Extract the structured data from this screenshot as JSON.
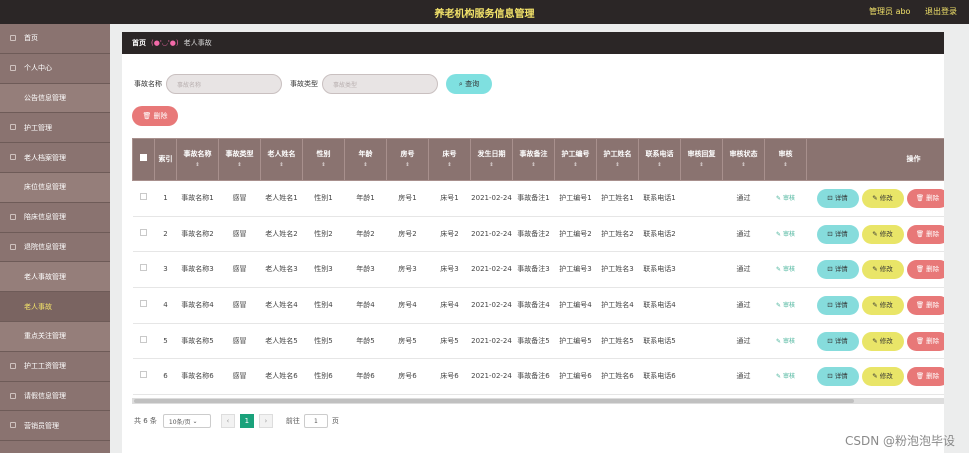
{
  "header": {
    "title": "养老机构服务信息管理",
    "user": "管理员 abo",
    "logout": "退出登录"
  },
  "sidebar": {
    "items": [
      {
        "label": "首页",
        "sub": false,
        "active": false
      },
      {
        "label": "个人中心",
        "sub": false,
        "active": false
      },
      {
        "label": "公告信息管理",
        "sub": true,
        "active": false
      },
      {
        "label": "护工管理",
        "sub": false,
        "active": false
      },
      {
        "label": "老人档案管理",
        "sub": false,
        "active": false
      },
      {
        "label": "床位信息管理",
        "sub": true,
        "active": false
      },
      {
        "label": "陪床信息管理",
        "sub": false,
        "active": false
      },
      {
        "label": "退院信息管理",
        "sub": false,
        "active": false
      },
      {
        "label": "老人事故管理",
        "sub": true,
        "active": false
      },
      {
        "label": "老人事故",
        "sub": true,
        "active": true
      },
      {
        "label": "重点关注管理",
        "sub": true,
        "active": false
      },
      {
        "label": "护工工资管理",
        "sub": false,
        "active": false
      },
      {
        "label": "请假信息管理",
        "sub": false,
        "active": false
      },
      {
        "label": "营销员管理",
        "sub": false,
        "active": false
      }
    ]
  },
  "breadcrumb": {
    "home": "首页",
    "sep": "(●'◡'●)",
    "current": "老人事故"
  },
  "search": {
    "name_label": "事故名称",
    "name_placeholder": "事故名称",
    "type_label": "事故类型",
    "type_placeholder": "事故类型",
    "query_button": "查询"
  },
  "toolbar": {
    "delete_button": "删除"
  },
  "table": {
    "columns": [
      "索引",
      "事故名称",
      "事故类型",
      "老人姓名",
      "性别",
      "年龄",
      "房号",
      "床号",
      "发生日期",
      "事故备注",
      "护工编号",
      "护工姓名",
      "联系电话",
      "审核回复",
      "审核状态",
      "审核",
      "操作"
    ],
    "rows": [
      [
        "1",
        "事故名称1",
        "感冒",
        "老人姓名1",
        "性别1",
        "年龄1",
        "房号1",
        "床号1",
        "2021-02-24",
        "事故备注1",
        "护工编号1",
        "护工姓名1",
        "联系电话1",
        "",
        "通过",
        "审核"
      ],
      [
        "2",
        "事故名称2",
        "感冒",
        "老人姓名2",
        "性别2",
        "年龄2",
        "房号2",
        "床号2",
        "2021-02-24",
        "事故备注2",
        "护工编号2",
        "护工姓名2",
        "联系电话2",
        "",
        "通过",
        "审核"
      ],
      [
        "3",
        "事故名称3",
        "感冒",
        "老人姓名3",
        "性别3",
        "年龄3",
        "房号3",
        "床号3",
        "2021-02-24",
        "事故备注3",
        "护工编号3",
        "护工姓名3",
        "联系电话3",
        "",
        "通过",
        "审核"
      ],
      [
        "4",
        "事故名称4",
        "感冒",
        "老人姓名4",
        "性别4",
        "年龄4",
        "房号4",
        "床号4",
        "2021-02-24",
        "事故备注4",
        "护工编号4",
        "护工姓名4",
        "联系电话4",
        "",
        "通过",
        "审核"
      ],
      [
        "5",
        "事故名称5",
        "感冒",
        "老人姓名5",
        "性别5",
        "年龄5",
        "房号5",
        "床号5",
        "2021-02-24",
        "事故备注5",
        "护工编号5",
        "护工姓名5",
        "联系电话5",
        "",
        "通过",
        "审核"
      ],
      [
        "6",
        "事故名称6",
        "感冒",
        "老人姓名6",
        "性别6",
        "年龄6",
        "房号6",
        "床号6",
        "2021-02-24",
        "事故备注6",
        "护工编号6",
        "护工姓名6",
        "联系电话6",
        "",
        "通过",
        "审核"
      ]
    ],
    "actions": {
      "detail": "详情",
      "edit": "修改",
      "delete": "删除"
    }
  },
  "pagination": {
    "total": "共 6 条",
    "page_size": "10条/页",
    "current_page": "1",
    "goto_label": "前往",
    "goto_value": "1",
    "page_suffix": "页"
  },
  "watermark": "CSDN @粉泡泡毕设"
}
